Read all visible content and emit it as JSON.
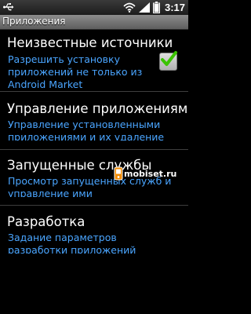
{
  "status_bar": {
    "time": "3:17",
    "icons": [
      "usb-icon",
      "wifi-icon",
      "signal-icon",
      "battery-icon"
    ]
  },
  "title_bar": {
    "title": "Приложения"
  },
  "settings": [
    {
      "title": "Неизвестные источники",
      "summary": "Разрешить установку\nприложений не только из\nAndroid Market",
      "checkbox": {
        "checked": true
      }
    },
    {
      "title": "Управление приложениями",
      "summary": "Управление установленными\nприложениями и их удаление"
    },
    {
      "title": "Запущенные службы",
      "summary": "Просмотр запущенных служб и\nуправление ими"
    },
    {
      "title": "Разработка",
      "summary": "Задание параметров\nразработки приложений"
    }
  ],
  "watermark": {
    "text": "mobiset.ru"
  },
  "colors": {
    "background": "#000000",
    "title_text": "#ffffff",
    "summary_text": "#4aa5ff",
    "check_green": "#3bc300",
    "header_bar": "#767676"
  }
}
